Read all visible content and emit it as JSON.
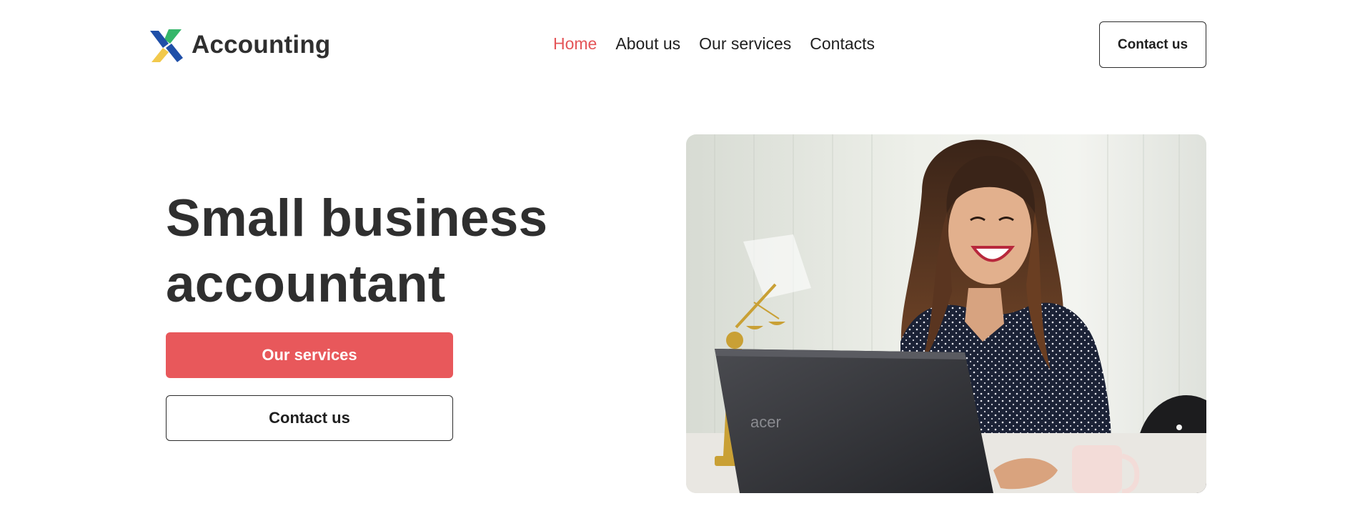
{
  "brand": {
    "name": "Accounting",
    "logo_icon": "x-cross-logo-icon",
    "colors": {
      "blue": "#1f4fa8",
      "green": "#35b66a",
      "yellow": "#f2c94c"
    }
  },
  "nav": {
    "items": [
      {
        "label": "Home",
        "active": true
      },
      {
        "label": "About us",
        "active": false
      },
      {
        "label": "Our services",
        "active": false
      },
      {
        "label": "Contacts",
        "active": false
      }
    ],
    "active_color": "#e45558"
  },
  "header": {
    "cta_label": "Contact us"
  },
  "hero": {
    "title_line1": "Small business",
    "title_line2": "accountant",
    "primary_button_label": "Our services",
    "secondary_button_label": "Contact us",
    "primary_color": "#e8585b",
    "image_alt": "Smiling woman with laptop at desk",
    "laptop_brand": "acer"
  }
}
